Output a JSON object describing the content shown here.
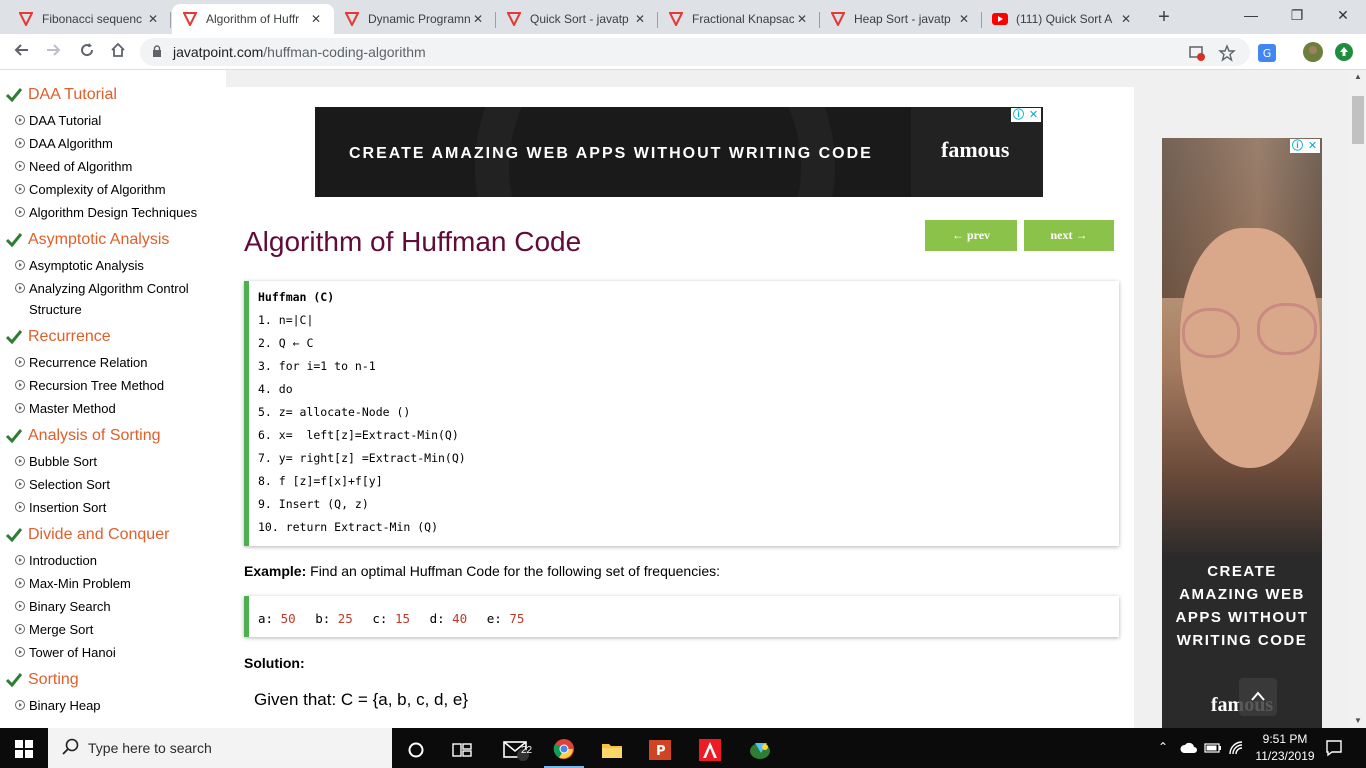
{
  "browser": {
    "tabs": [
      {
        "title": "Fibonacci sequenc",
        "favicon": "javatpoint-favicon",
        "active": false
      },
      {
        "title": "Algorithm of Huffr",
        "favicon": "javatpoint-favicon",
        "active": true
      },
      {
        "title": "Dynamic Programn",
        "favicon": "javatpoint-favicon",
        "active": false
      },
      {
        "title": "Quick Sort - javatp",
        "favicon": "javatpoint-favicon",
        "active": false
      },
      {
        "title": "Fractional Knapsac",
        "favicon": "javatpoint-favicon",
        "active": false
      },
      {
        "title": "Heap Sort - javatp",
        "favicon": "javatpoint-favicon",
        "active": false
      },
      {
        "title": "(111) Quick Sort A",
        "favicon": "youtube-favicon",
        "active": false
      }
    ],
    "close_glyph": "✕",
    "new_tab_glyph": "+",
    "url_host": "javatpoint.com",
    "url_path": "/huffman-coding-algorithm",
    "window_controls": {
      "minimize": "—",
      "restore": "❐",
      "close": "✕"
    }
  },
  "sidebar": {
    "sections": [
      {
        "title": "DAA Tutorial",
        "items": [
          "DAA Tutorial",
          "DAA Algorithm",
          "Need of Algorithm",
          "Complexity of Algorithm",
          "Algorithm Design Techniques"
        ]
      },
      {
        "title": "Asymptotic Analysis",
        "items": [
          "Asymptotic Analysis",
          "Analyzing Algorithm Control Structure"
        ]
      },
      {
        "title": "Recurrence",
        "items": [
          "Recurrence Relation",
          "Recursion Tree Method",
          "Master Method"
        ]
      },
      {
        "title": "Analysis of Sorting",
        "items": [
          "Bubble Sort",
          "Selection Sort",
          "Insertion Sort"
        ]
      },
      {
        "title": "Divide and Conquer",
        "items": [
          "Introduction",
          "Max-Min Problem",
          "Binary Search",
          "Merge Sort",
          "Tower of Hanoi"
        ]
      },
      {
        "title": "Sorting",
        "items": [
          "Binary Heap"
        ]
      }
    ]
  },
  "ad_top": {
    "text": "CREATE AMAZING WEB APPS WITHOUT WRITING CODE",
    "brand": "famous"
  },
  "ad_choices": {
    "info": "ⓘ",
    "close": "✕"
  },
  "page": {
    "title": "Algorithm of Huffman Code",
    "prev_label": "← prev",
    "next_label": "next →",
    "code_lines": [
      "Huffman (C)",
      "1. n=|C|",
      "2. Q ← C",
      "3. for i=1 to n-1",
      "4. do",
      "5. z= allocate-Node ()",
      "6. x=  left[z]=Extract-Min(Q)",
      "7. y= right[z] =Extract-Min(Q)",
      "8. f [z]=f[x]+f[y]",
      "9. Insert (Q, z)",
      "10. return Extract-Min (Q)"
    ],
    "example_label": "Example:",
    "example_text": " Find an optimal Huffman Code for the following set of frequencies:",
    "frequencies": [
      {
        "key": "a:",
        "value": "50"
      },
      {
        "key": "b:",
        "value": "25"
      },
      {
        "key": "c:",
        "value": "15"
      },
      {
        "key": "d:",
        "value": "40"
      },
      {
        "key": "e:",
        "value": "75"
      }
    ],
    "solution_label": "Solution:",
    "given_text": "Given that: C = {a, b, c, d, e}"
  },
  "ad_right": {
    "text_lines": [
      "CREATE",
      "AMAZING WEB",
      "APPS WITHOUT",
      "WRITING CODE"
    ],
    "brand": "famous"
  },
  "taskbar": {
    "search_placeholder": "Type here to search",
    "mail_badge": "22",
    "time": "9:51 PM",
    "date": "11/23/2019"
  },
  "colors": {
    "accent": "#e05f2a",
    "title": "#610b38",
    "button_green": "#8bc34a",
    "code_border": "#4caf50"
  }
}
